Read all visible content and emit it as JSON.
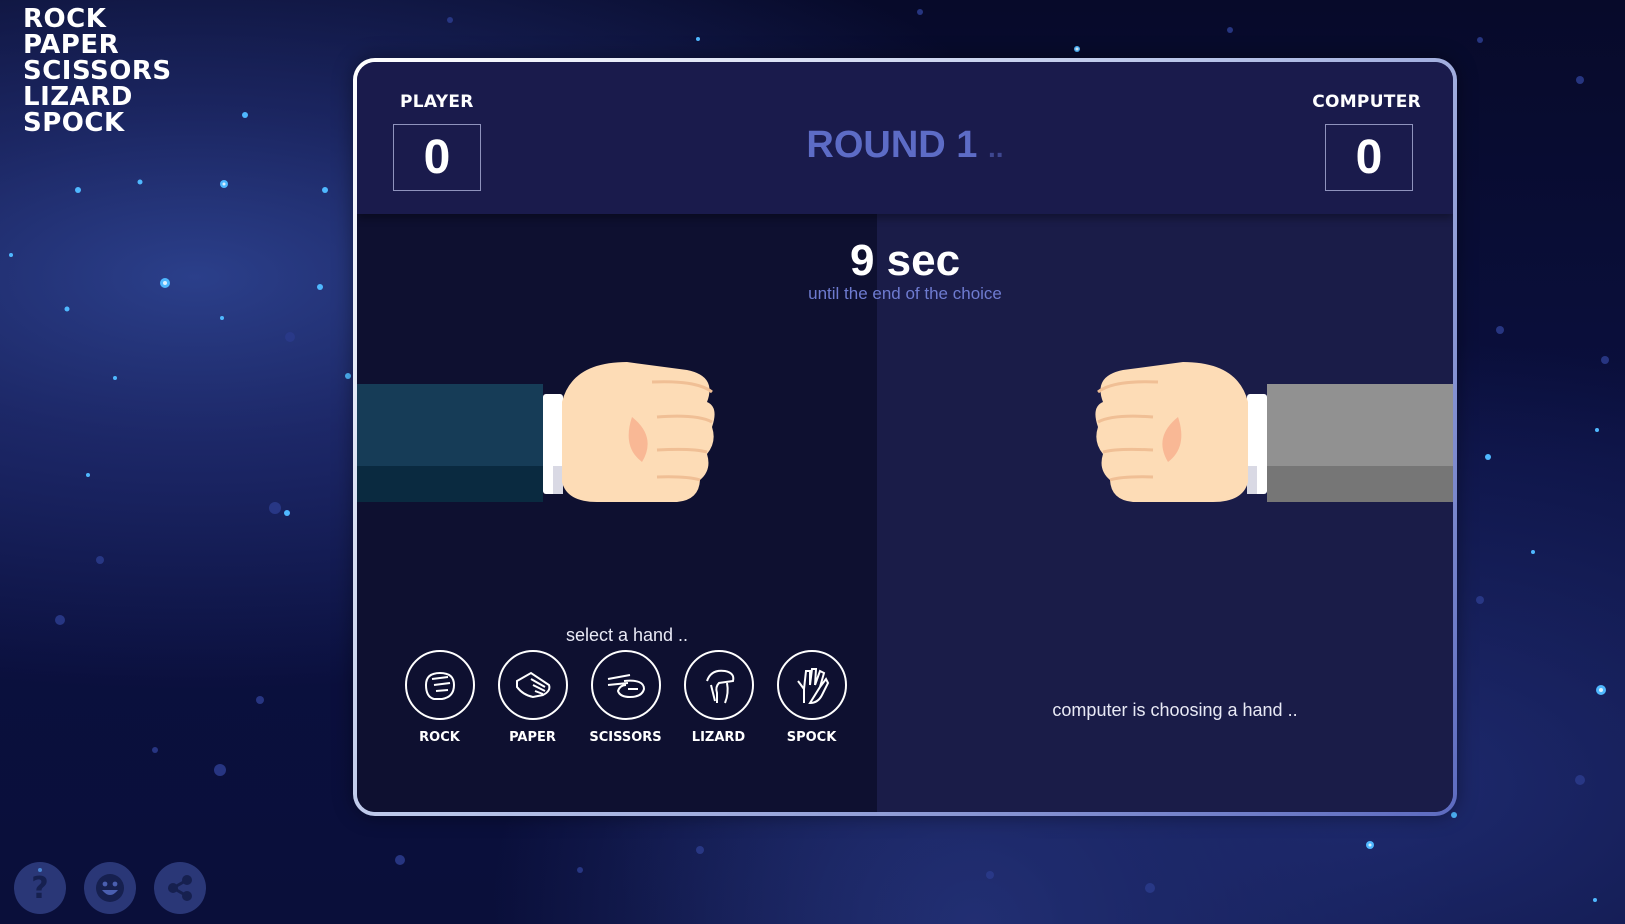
{
  "logo": {
    "lines": [
      "ROCK",
      "PAPER",
      "SCISSORS",
      "LIZARD",
      "SPOCK"
    ]
  },
  "scoreboard": {
    "player_label": "PLAYER",
    "player_score": "0",
    "computer_label": "COMPUTER",
    "computer_score": "0",
    "round_label": "ROUND 1",
    "round_dots": ".."
  },
  "timer": {
    "value": "9 sec",
    "subtitle": "until the end of the choice"
  },
  "player": {
    "prompt": "select a hand ..",
    "choices": [
      {
        "label": "ROCK",
        "icon": "rock-icon"
      },
      {
        "label": "PAPER",
        "icon": "paper-icon"
      },
      {
        "label": "SCISSORS",
        "icon": "scissors-icon"
      },
      {
        "label": "LIZARD",
        "icon": "lizard-icon"
      },
      {
        "label": "SPOCK",
        "icon": "spock-icon"
      }
    ]
  },
  "computer": {
    "status": "computer is choosing a hand .."
  },
  "bottom_bar": {
    "help": "?",
    "icons": [
      "help-icon",
      "smiley-icon",
      "share-icon"
    ]
  },
  "colors": {
    "accent": "#5d6cc6",
    "player_sleeve": "#163c57",
    "computer_sleeve": "#919191",
    "skin": "#fddcb6"
  }
}
